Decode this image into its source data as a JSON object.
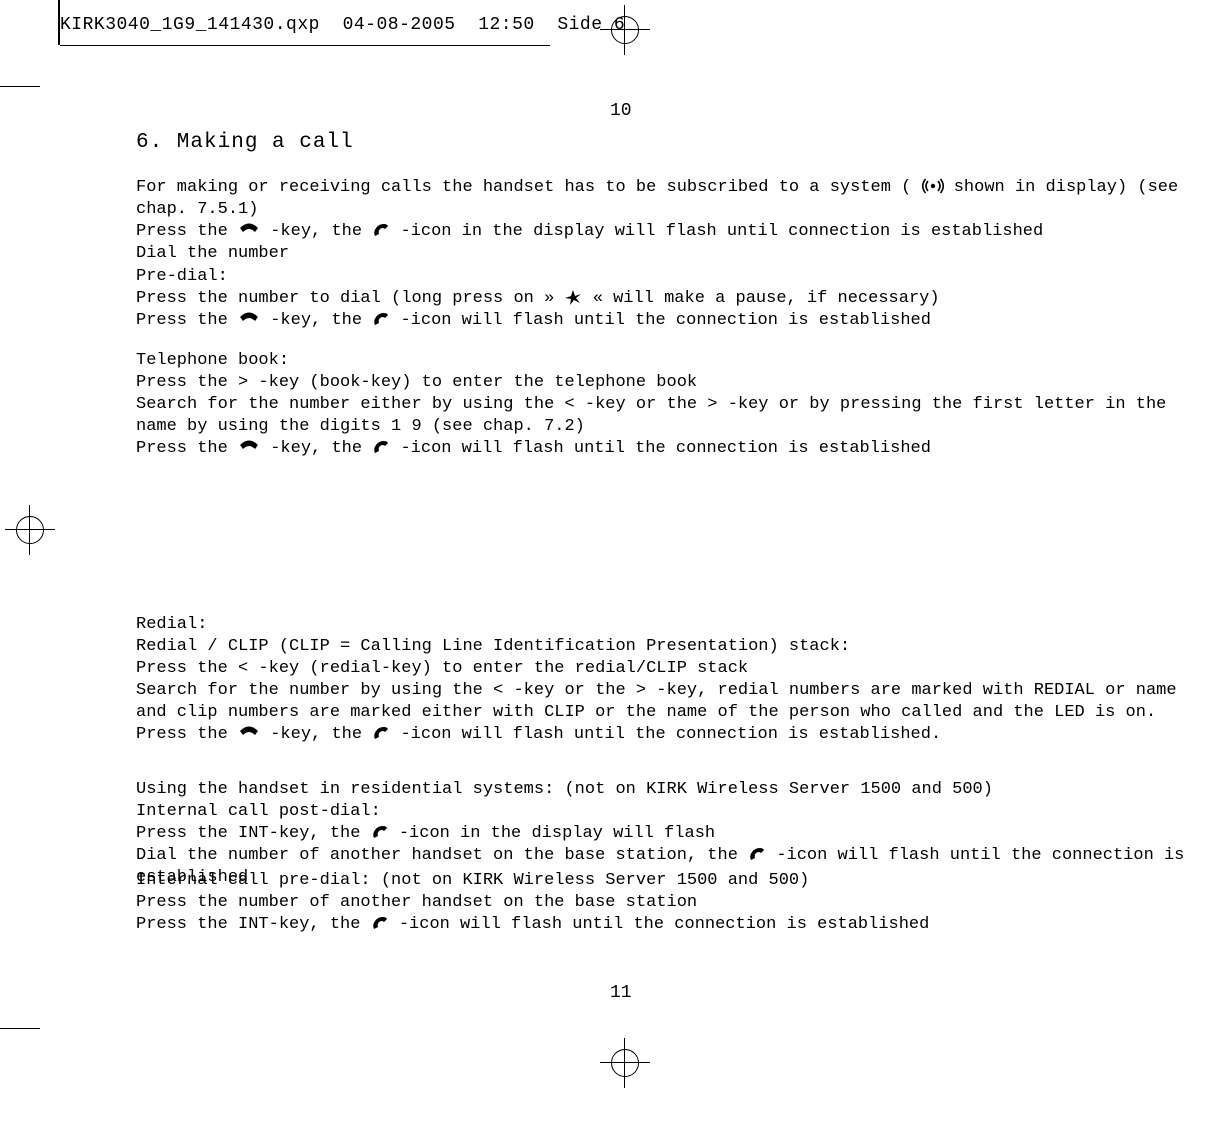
{
  "header": {
    "filename": "KIRK3040_1G9_141430.qxp",
    "date": "04-08-2005",
    "time": "12:50",
    "side": "Side 6"
  },
  "page_top": "10",
  "page_bottom": "11",
  "section_title": "6. Making a call",
  "block1": {
    "line1a": "For making or receiving calls the handset has to be subscribed to a system ( ",
    "line1b": " shown in display) (see chap. 7.5.1)",
    "line2a": "Press the ",
    "line2b": " -key, the ",
    "line2c": " -icon in the display will flash until connection is established",
    "line3": "Dial the number"
  },
  "block2": {
    "title": "Pre-dial:",
    "line1a": "Press the number to dial (long press on »",
    "line1b": "« will make a pause, if necessary)",
    "line2a": "Press the ",
    "line2b": " -key, the ",
    "line2c": " -icon will flash until the connection is established"
  },
  "block3": {
    "title": "Telephone book:",
    "line1": "Press the > -key (book-key) to enter the telephone book",
    "line2": "Search for the number either by using the < -key or the > -key or by pressing the first letter in the name by using the digits 1   9 (see chap. 7.2)",
    "line3a": "Press the ",
    "line3b": " -key, the ",
    "line3c": " -icon will flash until the connection is established"
  },
  "block4": {
    "title": "Redial:",
    "line1": "Redial / CLIP (CLIP = Calling Line Identification Presentation) stack:",
    "line2": "Press the < -key (redial-key) to enter the redial/CLIP stack",
    "line3": "Search for the number by using the < -key or the > -key, redial numbers are marked with REDIAL or name and clip numbers are marked either with CLIP or the name of the person who called and the LED is on.",
    "line4a": "Press the ",
    "line4b": " -key, the ",
    "line4c": " -icon will flash until the connection is established."
  },
  "block5": {
    "title": "Using the handset in residential systems: (not on KIRK Wireless Server 1500 and 500)",
    "line1": "Internal call post-dial:",
    "line2a": "Press the INT-key, the ",
    "line2b": " -icon in the display will flash",
    "line3a": "Dial the number of another handset on the base station, the ",
    "line3b": " -icon will flash until the connection is established"
  },
  "block6": {
    "title": "Internal call pre-dial: (not on KIRK Wireless Server 1500 and 500)",
    "line1": "Press the number of another handset on the base station",
    "line2a": "Press the INT-key, the ",
    "line2b": " -icon will flash until the connection is established"
  },
  "icons": {
    "signal": "signal-icon",
    "hook_down": "hook-key-icon",
    "hook_up": "hook-icon",
    "star": "star-key-icon"
  }
}
